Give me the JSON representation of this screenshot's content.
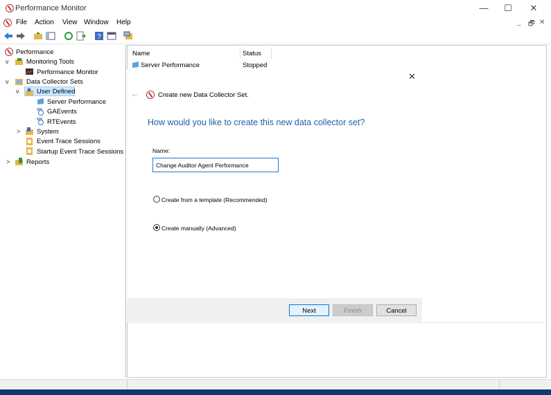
{
  "window": {
    "title": "Performance Monitor"
  },
  "window_controls": {
    "minimize": "—",
    "maximize": "☐",
    "close": "✕"
  },
  "menu": [
    "File",
    "Action",
    "View",
    "Window",
    "Help"
  ],
  "mdi_controls": {
    "minimize": "_",
    "restore": "🗗",
    "close": "✕"
  },
  "tree": {
    "performance": "Performance",
    "monitoring_tools": "Monitoring Tools",
    "performance_monitor": "Performance Monitor",
    "data_collector_sets": "Data Collector Sets",
    "user_defined": "User Defined",
    "server_performance": "Server Performance",
    "gaevents": "GAEvents",
    "rtevents": "RTEvents",
    "system": "System",
    "event_trace_sessions": "Event Trace Sessions",
    "startup_event_trace_sessions": "Startup Event Trace Sessions",
    "reports": "Reports"
  },
  "list": {
    "columns": [
      "Name",
      "Status"
    ],
    "rows": [
      {
        "name": "Server Performance",
        "status": "Stopped"
      }
    ]
  },
  "wizard": {
    "header": "Create new Data Collector Set.",
    "question": "How would you like to create this new data collector set?",
    "name_label": "Name:",
    "name_value": "Change Auditor Agent Performance",
    "option_template": "Create from a template (Recommended)",
    "option_manual": "Create manually (Advanced)",
    "selected_option": "manual",
    "next": "Next",
    "finish": "Finish",
    "cancel": "Cancel",
    "close_glyph": "✕",
    "back_glyph": "←",
    "accent_color": "#1f5fa6"
  }
}
